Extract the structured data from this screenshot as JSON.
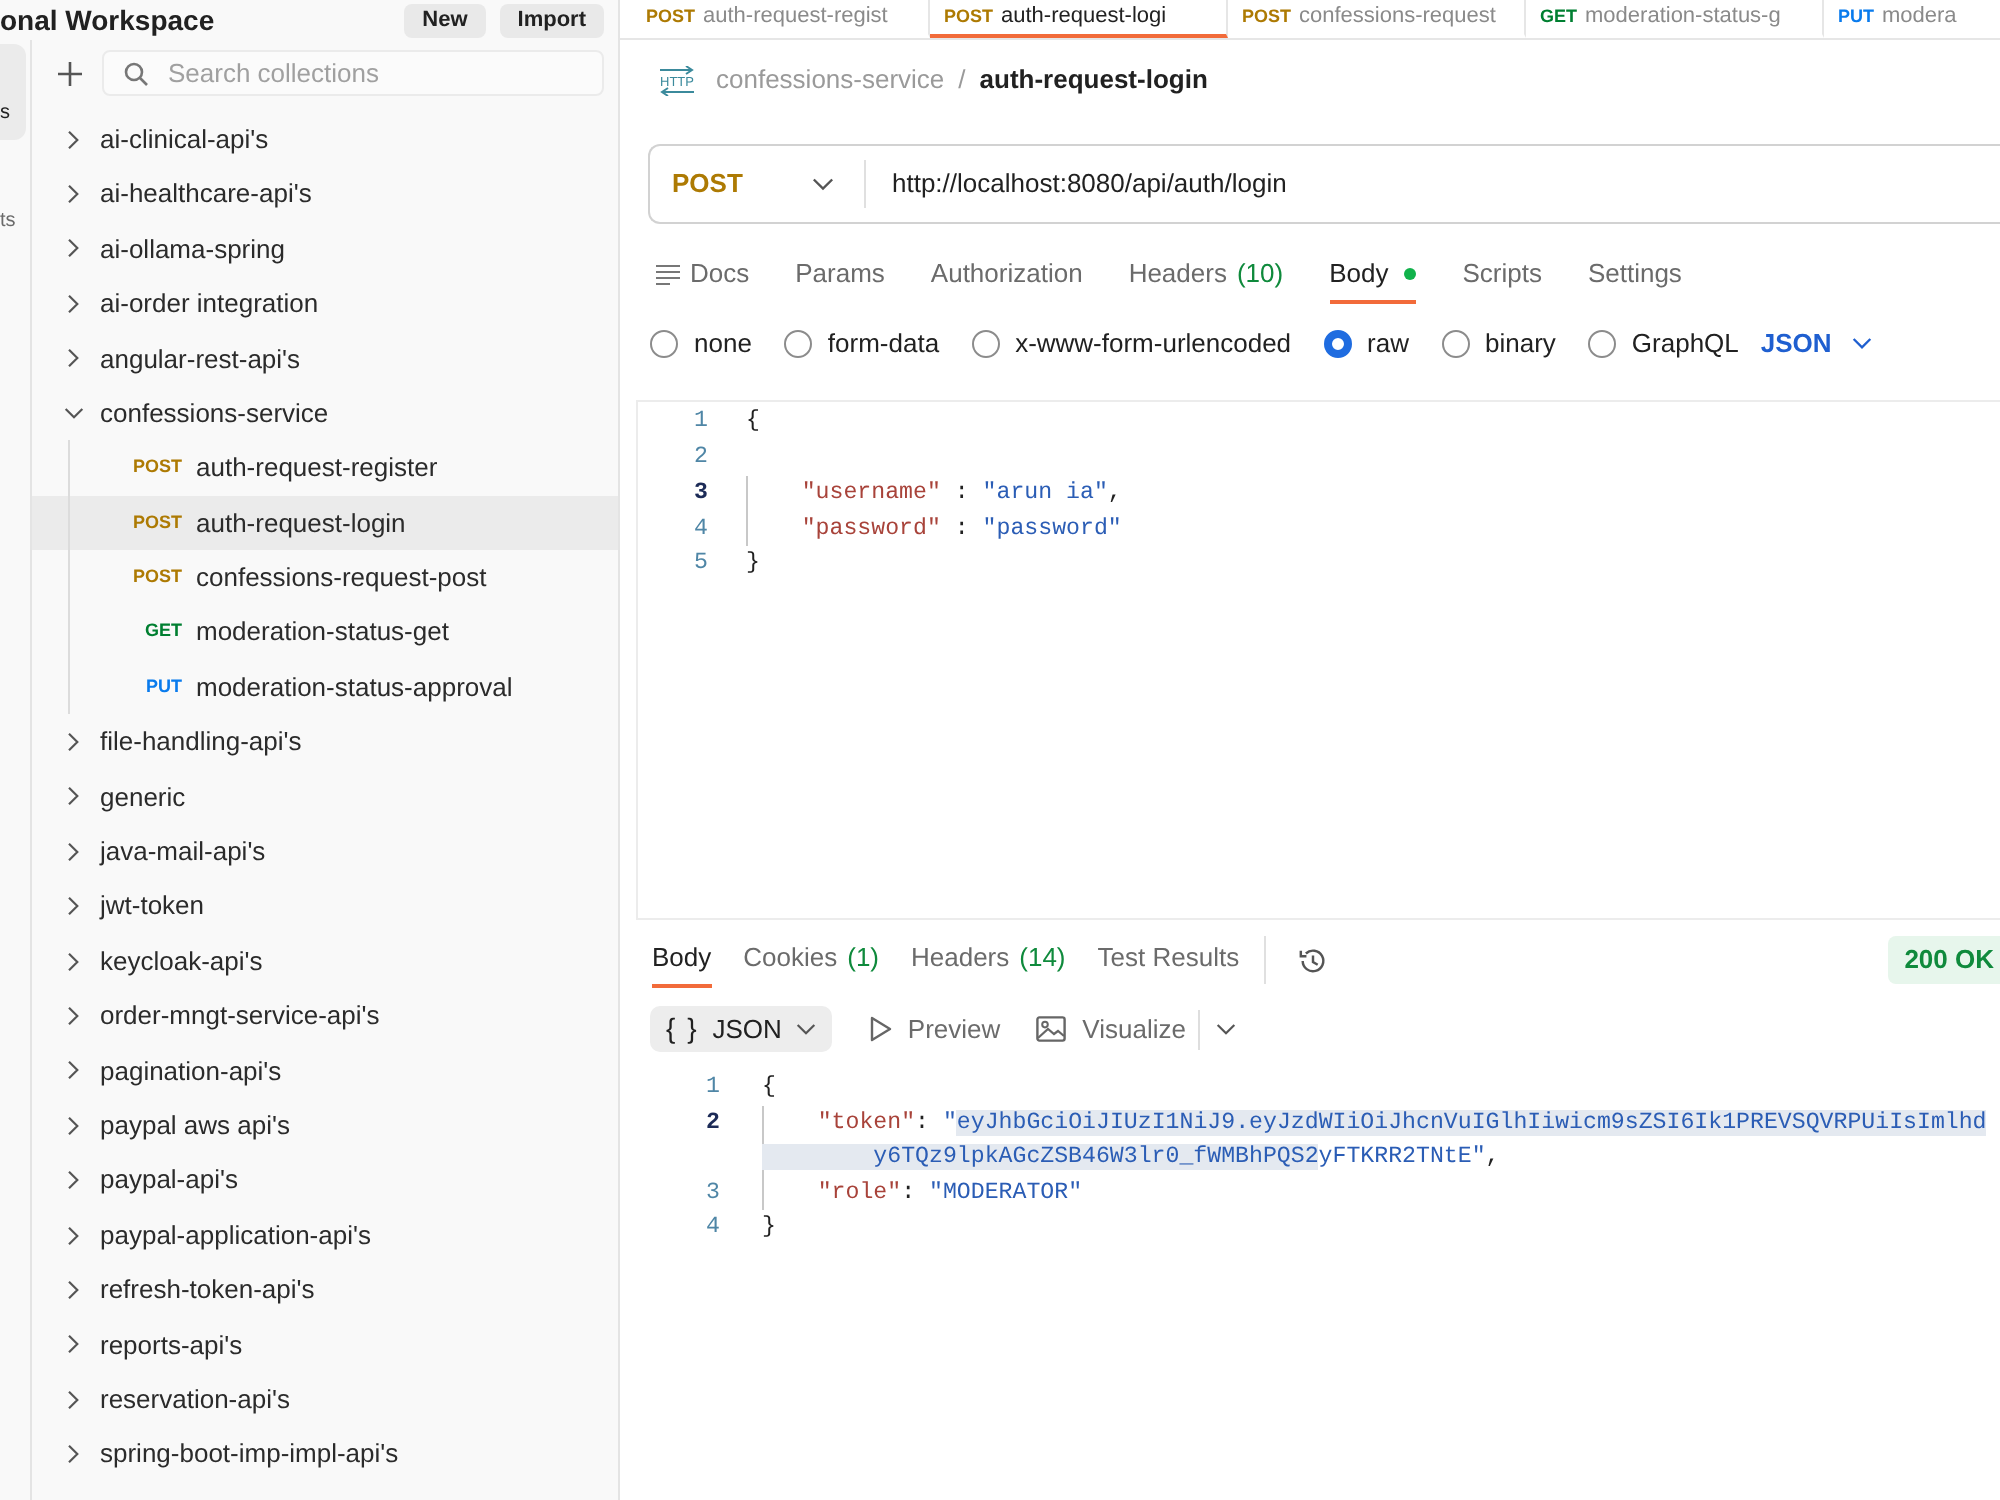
{
  "workspace": {
    "title": "onal Workspace",
    "buttons": [
      "New",
      "Import"
    ]
  },
  "open_tabs": [
    {
      "method": "POST",
      "color": "#ad7a03",
      "label": "auth-request-regist",
      "selected": false
    },
    {
      "method": "POST",
      "color": "#ad7a03",
      "label": "auth-request-logi",
      "selected": true
    },
    {
      "method": "POST",
      "color": "#ad7a03",
      "label": "confessions-request",
      "selected": false
    },
    {
      "method": "GET",
      "color": "#007f31",
      "label": "moderation-status-g",
      "selected": false
    },
    {
      "method": "PUT",
      "color": "#097bed",
      "label": "modera",
      "selected": false
    }
  ],
  "left_rail": [
    {
      "label": "s",
      "selected": true
    },
    {
      "label": "ts",
      "selected": false
    }
  ],
  "sidebar": {
    "search_placeholder": "Search collections",
    "collections": [
      {
        "name": "ai-clinical-api's",
        "expanded": false
      },
      {
        "name": "ai-healthcare-api's",
        "expanded": false
      },
      {
        "name": "ai-ollama-spring",
        "expanded": false
      },
      {
        "name": "ai-order integration",
        "expanded": false
      },
      {
        "name": "angular-rest-api's",
        "expanded": false
      },
      {
        "name": "confessions-service",
        "expanded": true,
        "children": [
          {
            "method": "POST",
            "color": "#ad7a03",
            "name": "auth-request-register",
            "selected": false
          },
          {
            "method": "POST",
            "color": "#ad7a03",
            "name": "auth-request-login",
            "selected": true
          },
          {
            "method": "POST",
            "color": "#ad7a03",
            "name": "confessions-request-post",
            "selected": false
          },
          {
            "method": "GET",
            "color": "#007f31",
            "name": "moderation-status-get",
            "selected": false
          },
          {
            "method": "PUT",
            "color": "#097bed",
            "name": "moderation-status-approval",
            "selected": false
          }
        ]
      },
      {
        "name": "file-handling-api's",
        "expanded": false
      },
      {
        "name": "generic",
        "expanded": false
      },
      {
        "name": "java-mail-api's",
        "expanded": false
      },
      {
        "name": "jwt-token",
        "expanded": false
      },
      {
        "name": "keycloak-api's",
        "expanded": false
      },
      {
        "name": "order-mngt-service-api's",
        "expanded": false
      },
      {
        "name": "pagination-api's",
        "expanded": false
      },
      {
        "name": "paypal aws api's",
        "expanded": false
      },
      {
        "name": "paypal-api's",
        "expanded": false
      },
      {
        "name": "paypal-application-api's",
        "expanded": false
      },
      {
        "name": "refresh-token-api's",
        "expanded": false
      },
      {
        "name": "reports-api's",
        "expanded": false
      },
      {
        "name": "reservation-api's",
        "expanded": false
      },
      {
        "name": "spring-boot-imp-impl-api's",
        "expanded": false
      }
    ]
  },
  "request": {
    "type_label": "HTTP",
    "breadcrumb": {
      "parent": "confessions-service",
      "separator": "/",
      "name": "auth-request-login"
    },
    "method": "POST",
    "url": "http://localhost:8080/api/auth/login",
    "tabs": [
      {
        "label": "Docs",
        "kind": "docs",
        "selected": false,
        "modified": false
      },
      {
        "label": "Params",
        "kind": "plain",
        "selected": false,
        "modified": false
      },
      {
        "label": "Authorization",
        "kind": "plain",
        "selected": false,
        "modified": false
      },
      {
        "label": "Headers",
        "kind": "plain",
        "count": "(10)",
        "selected": false,
        "modified": false
      },
      {
        "label": "Body",
        "kind": "plain",
        "selected": true,
        "modified": true
      },
      {
        "label": "Scripts",
        "kind": "plain",
        "selected": false,
        "modified": false
      },
      {
        "label": "Settings",
        "kind": "plain",
        "selected": false,
        "modified": false
      }
    ],
    "body_types": [
      {
        "label": "none",
        "selected": false
      },
      {
        "label": "form-data",
        "selected": false
      },
      {
        "label": "x-www-form-urlencoded",
        "selected": false
      },
      {
        "label": "raw",
        "selected": true
      },
      {
        "label": "binary",
        "selected": false
      },
      {
        "label": "GraphQL",
        "selected": false
      }
    ],
    "body_format": "JSON",
    "editor_lines": [
      {
        "number": "1",
        "active": false,
        "tokens": [
          {
            "kind": "punct",
            "text": "{"
          }
        ]
      },
      {
        "number": "2",
        "active": false
      },
      {
        "number": "3",
        "active": true,
        "tokens": [
          {
            "kind": "key",
            "text": "    \"username\""
          },
          {
            "kind": "punct",
            "text": " : "
          },
          {
            "kind": "string",
            "text": "\"arun ia\""
          },
          {
            "kind": "punct",
            "text": ","
          }
        ]
      },
      {
        "number": "4",
        "active": false,
        "tokens": [
          {
            "kind": "key",
            "text": "    \"password\""
          },
          {
            "kind": "punct",
            "text": " : "
          },
          {
            "kind": "string",
            "text": "\"password\""
          }
        ]
      },
      {
        "number": "5",
        "active": false,
        "tokens": [
          {
            "kind": "punct",
            "text": "}"
          }
        ]
      }
    ]
  },
  "response": {
    "tabs": [
      {
        "label": "Body",
        "selected": true
      },
      {
        "label": "Cookies",
        "count": "(1)",
        "selected": false
      },
      {
        "label": "Headers",
        "count": "(14)",
        "selected": false
      },
      {
        "label": "Test Results",
        "selected": false
      }
    ],
    "status": "200 OK",
    "format": {
      "icon_text": "{ }",
      "label": "JSON"
    },
    "views": [
      {
        "kind": "preview",
        "label": "Preview"
      },
      {
        "kind": "visualize",
        "label": "Visualize"
      }
    ],
    "lines": [
      {
        "number": "1",
        "active": false,
        "tokens": [
          {
            "kind": "punct",
            "text": "{",
            "selected": false
          }
        ]
      },
      {
        "number": "2",
        "active": true,
        "tokens": [
          {
            "kind": "key",
            "text": "    \"token\"",
            "selected": false
          },
          {
            "kind": "punct",
            "text": ": ",
            "selected": false
          },
          {
            "kind": "string",
            "text": "\"",
            "selected": false
          },
          {
            "kind": "string",
            "text": "eyJhbGciOiJIUzI1NiJ9.eyJzdWIiOiJhcnVuIGlhIiwicm9sZSI6Ik1PREVSQVRPUiIsImlhd",
            "selected": true
          }
        ]
      },
      {
        "tokens": [
          {
            "kind": "string",
            "text": "        y6TQz9lpkAGcZSB46W3lr0_fWMBhPQS2",
            "selected": true
          },
          {
            "kind": "string",
            "text": "yFTKRR2TNtE\"",
            "selected": false
          },
          {
            "kind": "punct",
            "text": ",",
            "selected": false
          }
        ]
      },
      {
        "number": "3",
        "active": false,
        "tokens": [
          {
            "kind": "key",
            "text": "    \"role\"",
            "selected": false
          },
          {
            "kind": "punct",
            "text": ": ",
            "selected": false
          },
          {
            "kind": "string",
            "text": "\"MODERATOR\"",
            "selected": false
          }
        ]
      },
      {
        "number": "4",
        "active": false,
        "tokens": [
          {
            "kind": "punct",
            "text": "}",
            "selected": false
          }
        ]
      }
    ]
  }
}
